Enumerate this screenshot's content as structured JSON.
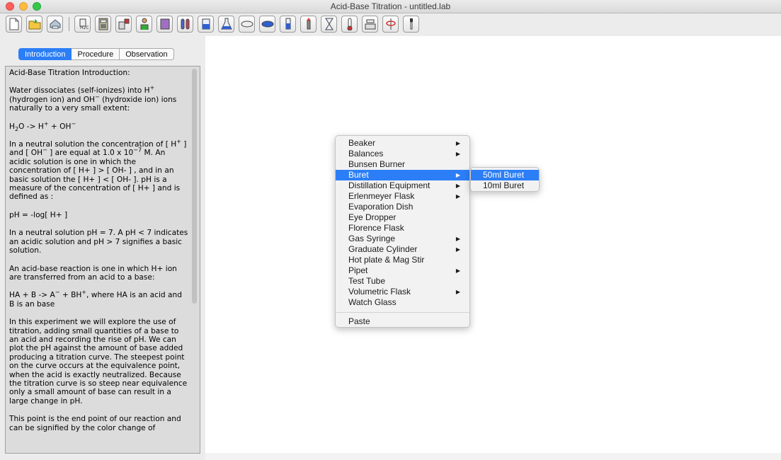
{
  "window": {
    "title": "Acid-Base Titration - untitled.lab"
  },
  "toolbar": {
    "buttons": [
      "new-document-icon",
      "open-folder-icon",
      "print-icon",
      "ph-meter-icon",
      "calculator-icon",
      "chemical-bottle-icon",
      "scientist-icon",
      "container-icon",
      "test-tubes-icon",
      "beaker-icon",
      "erlenmeyer-flask-icon",
      "watch-glass-icon",
      "evaporation-dish-icon",
      "graduated-cylinder-icon",
      "burner-icon",
      "hourglass-icon",
      "thermometer-icon",
      "balance-icon",
      "ring-stand-icon",
      "dropper-icon"
    ]
  },
  "tabs": [
    {
      "label": "Introduction",
      "active": true
    },
    {
      "label": "Procedure",
      "active": false
    },
    {
      "label": "Observation",
      "active": false
    }
  ],
  "intro": {
    "heading": "Acid-Base Titration Introduction:",
    "p1_a": "Water dissociates (self-ionizes) into H",
    "p1_sup1": "+",
    "p1_b": "(hydrogen ion)  and OH",
    "p1_sup2": "−",
    "p1_c": "  (hydroxide ion) ions naturally to a  very small extent:",
    "eq1_a": "H",
    "eq1_sub": "2",
    "eq1_b": "O  -> H",
    "eq1_sup1": "+",
    "eq1_c": "  +  OH",
    "eq1_sup2": "−",
    "p2_a": "In a neutral solution  the concentration of [ H",
    "p2_sup1": "+",
    "p2_b": " ] and [ OH",
    "p2_sup2": "−",
    "p2_c": " ]  are equal at 1.0 x 10",
    "p2_sup3": "−7",
    "p2_d": " M. An acidic solution is one in which the concentration of  [ H+ ] > [ OH- ] , and in an basic solution the [ H+ ]  <  [ OH- ].  pH  is a measure of the concentration of [ H+ ] and is defined as :",
    "eq2": "pH = -log[ H+  ]",
    "p3": "In a neutral solution pH = 7.  A  pH < 7 indicates an acidic solution and pH > 7 signifies a basic solution.",
    "p4": "An acid-base reaction is one in which  H+ ion are transferred from an acid to a base:",
    "eq3_a": "HA  + B  ->  A",
    "eq3_sup1": "−",
    "eq3_b": "  +  BH",
    "eq3_sup2": "+",
    "eq3_c": ",   where HA is an acid and B is an base",
    "p5": "In this experiment we will explore the use of titration, adding small quantities of a base to an acid and recording the rise of  pH. We can plot the pH against the amount of base added producing a titration curve. The steepest point on the curve occurs at the equivalence point, when the acid is exactly neutralized. Because the titration curve is so steep near equivalence only a small amount of  base can result in a large change in pH.",
    "p6": "This point is the end point of our reaction and can be signified by the color change of"
  },
  "menu": {
    "items": [
      {
        "label": "Beaker",
        "submenu": true,
        "selected": false
      },
      {
        "label": "Balances",
        "submenu": true,
        "selected": false
      },
      {
        "label": "Bunsen Burner",
        "submenu": false,
        "selected": false
      },
      {
        "label": "Buret",
        "submenu": true,
        "selected": true
      },
      {
        "label": "Distillation Equipment",
        "submenu": true,
        "selected": false
      },
      {
        "label": "Erlenmeyer Flask",
        "submenu": true,
        "selected": false
      },
      {
        "label": "Evaporation Dish",
        "submenu": false,
        "selected": false
      },
      {
        "label": "Eye Dropper",
        "submenu": false,
        "selected": false
      },
      {
        "label": "Florence Flask",
        "submenu": false,
        "selected": false
      },
      {
        "label": "Gas Syringe",
        "submenu": true,
        "selected": false
      },
      {
        "label": "Graduate Cylinder",
        "submenu": true,
        "selected": false
      },
      {
        "label": "Hot plate & Mag Stir",
        "submenu": false,
        "selected": false
      },
      {
        "label": "Pipet",
        "submenu": true,
        "selected": false
      },
      {
        "label": "Test Tube",
        "submenu": false,
        "selected": false
      },
      {
        "label": "Volumetric Flask",
        "submenu": true,
        "selected": false
      },
      {
        "label": "Watch Glass",
        "submenu": false,
        "selected": false
      }
    ],
    "paste": "Paste",
    "arrow": "▶"
  },
  "submenu": {
    "items": [
      {
        "label": "50ml Buret",
        "selected": true
      },
      {
        "label": "10ml Buret",
        "selected": false
      }
    ]
  },
  "colors": {
    "accent": "#2c7ef6",
    "panel": "#dcdcdc",
    "chrome": "#ececec"
  }
}
